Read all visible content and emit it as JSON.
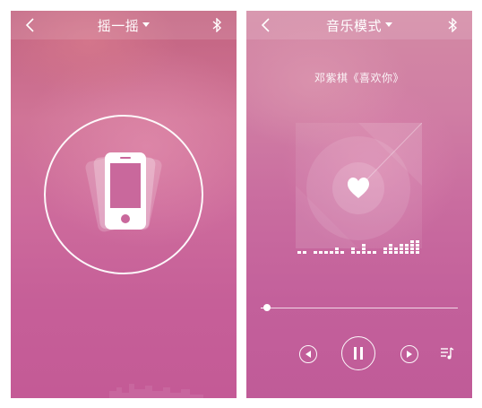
{
  "left_screen": {
    "title": "摇一摇",
    "icons": [
      "back-icon",
      "caret-down-icon",
      "bluetooth-icon",
      "shake-phone-icon"
    ],
    "accent": "#c8649a"
  },
  "right_screen": {
    "title": "音乐模式",
    "song_label": "邓紫棋《喜欢你》",
    "progress": 0.03,
    "equalizer_levels": [
      1,
      1,
      0,
      1,
      1,
      1,
      1,
      2,
      1,
      0,
      2,
      1,
      3,
      1,
      1,
      0,
      2,
      3,
      2,
      3,
      3,
      4,
      4
    ],
    "icons": [
      "back-icon",
      "caret-down-icon",
      "bluetooth-icon",
      "heart-icon",
      "prev-icon",
      "pause-icon",
      "next-icon",
      "playlist-icon"
    ],
    "accent": "#c45d99"
  }
}
